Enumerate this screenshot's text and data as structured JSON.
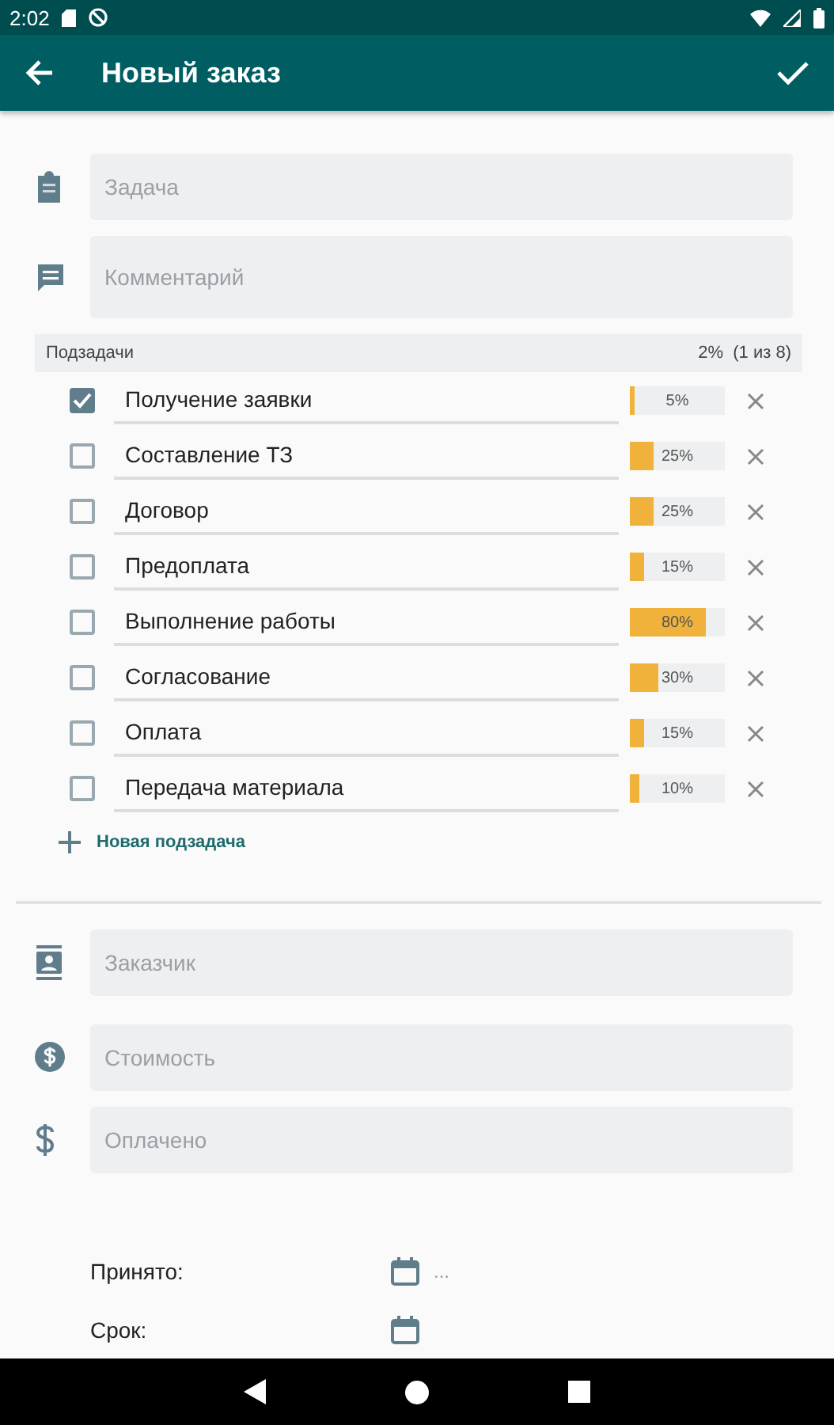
{
  "status_bar": {
    "time": "2:02"
  },
  "app_bar": {
    "title": "Новый заказ"
  },
  "top_fields": [
    {
      "kind": "task",
      "placeholder": "Задача"
    },
    {
      "kind": "comment",
      "placeholder": "Комментарий"
    }
  ],
  "subtasks": {
    "title": "Подзадачи",
    "summary": "2%  (1 из 8)",
    "items": [
      {
        "name": "Получение заявки",
        "checked": true,
        "level": 0.05,
        "reading": "5%"
      },
      {
        "name": "Составление ТЗ",
        "checked": false,
        "level": 0.25,
        "reading": "25%"
      },
      {
        "name": "Договор",
        "checked": false,
        "level": 0.25,
        "reading": "25%"
      },
      {
        "name": "Предоплата",
        "checked": false,
        "level": 0.15,
        "reading": "15%"
      },
      {
        "name": "Выполнение работы",
        "checked": false,
        "level": 0.8,
        "reading": "80%"
      },
      {
        "name": "Согласование",
        "checked": false,
        "level": 0.3,
        "reading": "30%"
      },
      {
        "name": "Оплата",
        "checked": false,
        "level": 0.15,
        "reading": "15%"
      },
      {
        "name": "Передача материала",
        "checked": false,
        "level": 0.1,
        "reading": "10%"
      }
    ],
    "add_label": "Новая подзадача"
  },
  "bottom_fields": [
    {
      "kind": "customer",
      "placeholder": "Заказчик"
    },
    {
      "kind": "cost",
      "placeholder": "Стоимость"
    },
    {
      "kind": "paid",
      "placeholder": "Оплачено"
    }
  ],
  "dates": [
    {
      "label": "Принято:",
      "value": "..."
    },
    {
      "label": "Срок:"
    }
  ]
}
